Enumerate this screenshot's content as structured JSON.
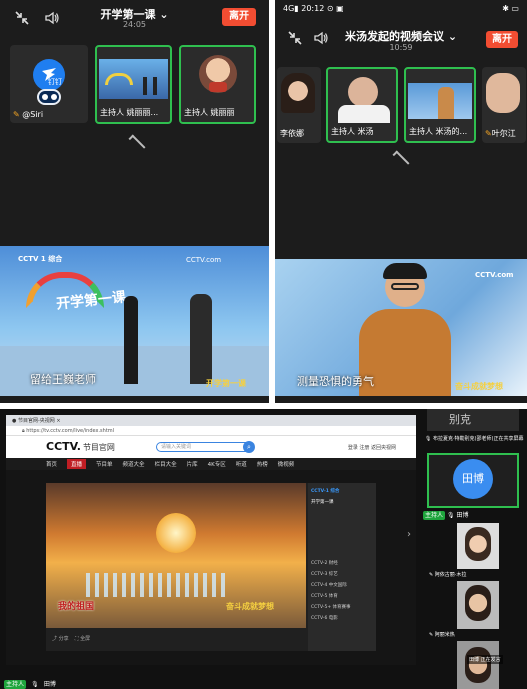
{
  "panel_a": {
    "title": "开学第一课",
    "timer": "24:05",
    "leave": "离开",
    "tiles": [
      {
        "name": "@Siri",
        "app_badge": "钉钉"
      },
      {
        "role": "主持人",
        "name": "姚丽丽..."
      },
      {
        "role": "主持人",
        "name": "姚丽丽"
      }
    ],
    "stage": {
      "logo": "CCTV 1 综合",
      "banner_text": "开学第一课",
      "caption": "留给王巍老师",
      "logo_right": "CCTV.com",
      "corner_text": "开学第一课"
    }
  },
  "panel_b": {
    "status_time": "20:12",
    "title": "米汤发起的视频会议",
    "timer": "10:59",
    "leave": "离开",
    "tiles": [
      {
        "name": "李依娜"
      },
      {
        "role": "主持人",
        "name": "米汤"
      },
      {
        "role": "主持人",
        "name": "米汤的..."
      },
      {
        "name": "叶尔江"
      }
    ],
    "stage": {
      "logo_right": "CCTV.com",
      "caption": "测量恐惧的勇气",
      "corner_text": "奋斗成就梦想"
    }
  },
  "panel_c": {
    "browser": {
      "tab_title": "节目官网-央视网",
      "url": "https://tv.cctv.com/live/index.shtml",
      "site_logo": "CCTV.",
      "site_sub": "节目官网",
      "search_placeholder": "请输入关键词",
      "head_links": "登录  注册  返回央视网",
      "nav": [
        "首页",
        "直播",
        "节目单",
        "频道大全",
        "栏目大全",
        "片库",
        "4K专区",
        "听道",
        "热榜",
        "微视频"
      ],
      "nav_active": "直播",
      "channels_title": "CCTV-1 综合",
      "channels": [
        "开学第一课",
        "CCTV-1 综合",
        "CCTV-2 财经",
        "CCTV-3 综艺",
        "CCTV-4 中文国际",
        "CCTV-5 体育",
        "CCTV-5+ 体育赛事",
        "CCTV-6 电影"
      ],
      "video_caption": "我的祖国",
      "video_corner": "奋斗成就梦想",
      "share_label": "分享",
      "fullscreen_label": "全屏"
    },
    "side": {
      "top_note": "布拉夏克·特勒别克(邵老师)正在共享屏幕",
      "big_name_1": "别克",
      "big_name_2": "田博",
      "host_tag": "主持人",
      "host_name": "田博",
      "p3": "阿依古丽·木拉",
      "p4": "阿丽米热",
      "speaking_name": "田博",
      "speaking_text": "正在发言"
    },
    "bottom_bar": {
      "host_tag": "主持人",
      "host_name": "田博"
    }
  }
}
